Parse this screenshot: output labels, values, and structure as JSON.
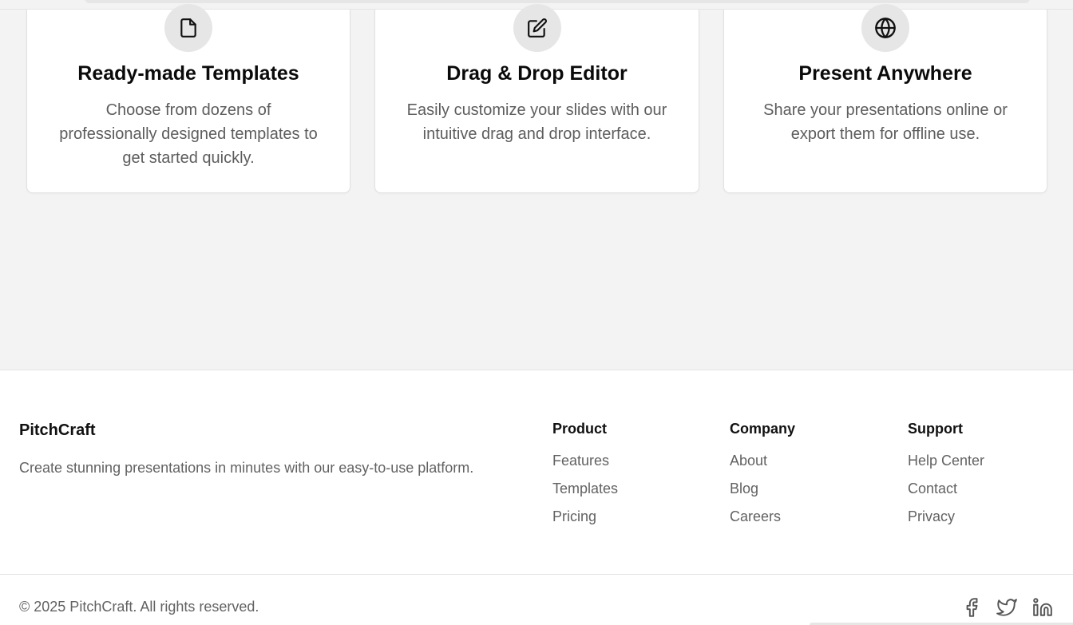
{
  "features": [
    {
      "title": "Ready-made Templates",
      "description": "Choose from dozens of professionally designed templates to get started quickly.",
      "icon": "file-icon"
    },
    {
      "title": "Drag & Drop Editor",
      "description": "Easily customize your slides with our intuitive drag and drop interface.",
      "icon": "edit-icon"
    },
    {
      "title": "Present Anywhere",
      "description": "Share your presentations online or export them for offline use.",
      "icon": "globe-icon"
    }
  ],
  "footer": {
    "brand": "PitchCraft",
    "tagline": "Create stunning presentations in minutes with our easy-to-use platform.",
    "columns": [
      {
        "heading": "Product",
        "links": [
          "Features",
          "Templates",
          "Pricing"
        ]
      },
      {
        "heading": "Company",
        "links": [
          "About",
          "Blog",
          "Careers"
        ]
      },
      {
        "heading": "Support",
        "links": [
          "Help Center",
          "Contact",
          "Privacy"
        ]
      }
    ],
    "copyright": "© 2025 PitchCraft. All rights reserved.",
    "social": [
      "facebook-icon",
      "twitter-icon",
      "linkedin-icon"
    ]
  },
  "colors": {
    "page_bg": "#f3f3f3",
    "card_bg": "#ffffff",
    "icon_circle": "#e6e6e6",
    "heading": "#0a0a0a",
    "muted_text": "#626262"
  }
}
